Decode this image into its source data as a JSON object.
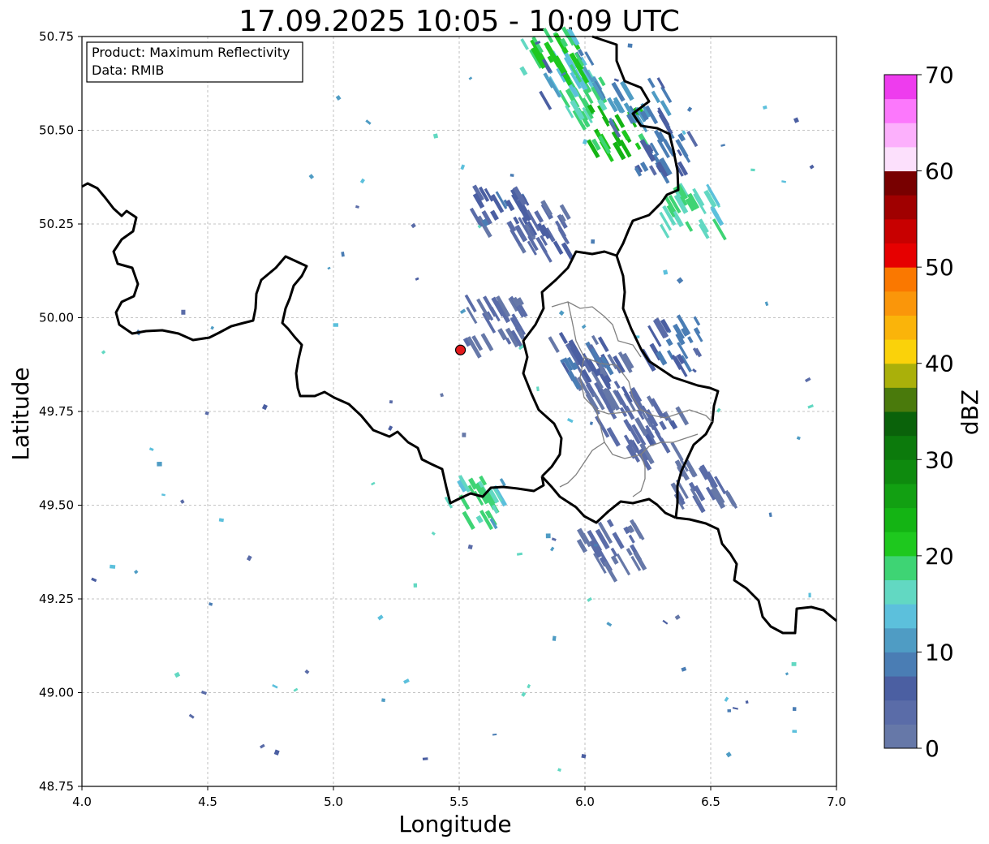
{
  "chart_data": {
    "type": "radar-map",
    "title": "17.09.2025 10:05 - 10:09 UTC",
    "xlabel": "Longitude",
    "ylabel": "Latitude",
    "xlim": [
      4.0,
      7.0
    ],
    "ylim": [
      48.75,
      50.75
    ],
    "xticks": [
      "4.0",
      "4.5",
      "5.0",
      "5.5",
      "6.0",
      "6.5",
      "7.0"
    ],
    "yticks": [
      "48.75",
      "49.00",
      "49.25",
      "49.50",
      "49.75",
      "50.00",
      "50.25",
      "50.50",
      "50.75"
    ],
    "grid": true,
    "info_box": {
      "product": "Product: Maximum Reflectivity",
      "data": "Data: RMIB"
    },
    "radar_site": {
      "lon": 5.505,
      "lat": 49.914,
      "color": "#e31a1c"
    },
    "colorbar": {
      "label": "dBZ",
      "ticks": [
        "0",
        "10",
        "20",
        "30",
        "40",
        "50",
        "60",
        "70"
      ],
      "range": [
        0,
        70
      ],
      "colors": [
        "#6678a8",
        "#5a6ca8",
        "#4b5fa2",
        "#4a7db4",
        "#4f9cc4",
        "#5cc0dc",
        "#62d8c2",
        "#3ed474",
        "#1ec81e",
        "#14b414",
        "#12a012",
        "#0e8a0e",
        "#0c7a0c",
        "#0a620a",
        "#4a7a0c",
        "#aab00a",
        "#fad20a",
        "#fab40a",
        "#fa960a",
        "#fa7800",
        "#e60000",
        "#c80000",
        "#a00000",
        "#780000",
        "#fce0fc",
        "#fcb0fc",
        "#fc78fc",
        "#ee3cee"
      ]
    },
    "echoes": [
      {
        "lon": 5.98,
        "lat": 50.6,
        "dbz": 20
      },
      {
        "lon": 6.1,
        "lat": 50.52,
        "dbz": 25
      },
      {
        "lon": 5.92,
        "lat": 50.66,
        "dbz": 15
      },
      {
        "lon": 6.3,
        "lat": 50.45,
        "dbz": 10
      },
      {
        "lon": 5.85,
        "lat": 50.72,
        "dbz": 22
      },
      {
        "lon": 6.2,
        "lat": 50.58,
        "dbz": 12
      },
      {
        "lon": 5.65,
        "lat": 50.3,
        "dbz": 8
      },
      {
        "lon": 5.8,
        "lat": 50.25,
        "dbz": 6
      },
      {
        "lon": 6.05,
        "lat": 49.85,
        "dbz": 6
      },
      {
        "lon": 6.15,
        "lat": 49.75,
        "dbz": 5
      },
      {
        "lon": 5.95,
        "lat": 49.9,
        "dbz": 8
      },
      {
        "lon": 6.25,
        "lat": 49.7,
        "dbz": 6
      },
      {
        "lon": 6.33,
        "lat": 49.95,
        "dbz": 10
      },
      {
        "lon": 6.4,
        "lat": 50.3,
        "dbz": 20
      },
      {
        "lon": 5.55,
        "lat": 49.52,
        "dbz": 20
      },
      {
        "lon": 6.45,
        "lat": 49.57,
        "dbz": 5
      },
      {
        "lon": 6.08,
        "lat": 49.4,
        "dbz": 5
      },
      {
        "lon": 5.62,
        "lat": 50.0,
        "dbz": 5
      }
    ]
  }
}
